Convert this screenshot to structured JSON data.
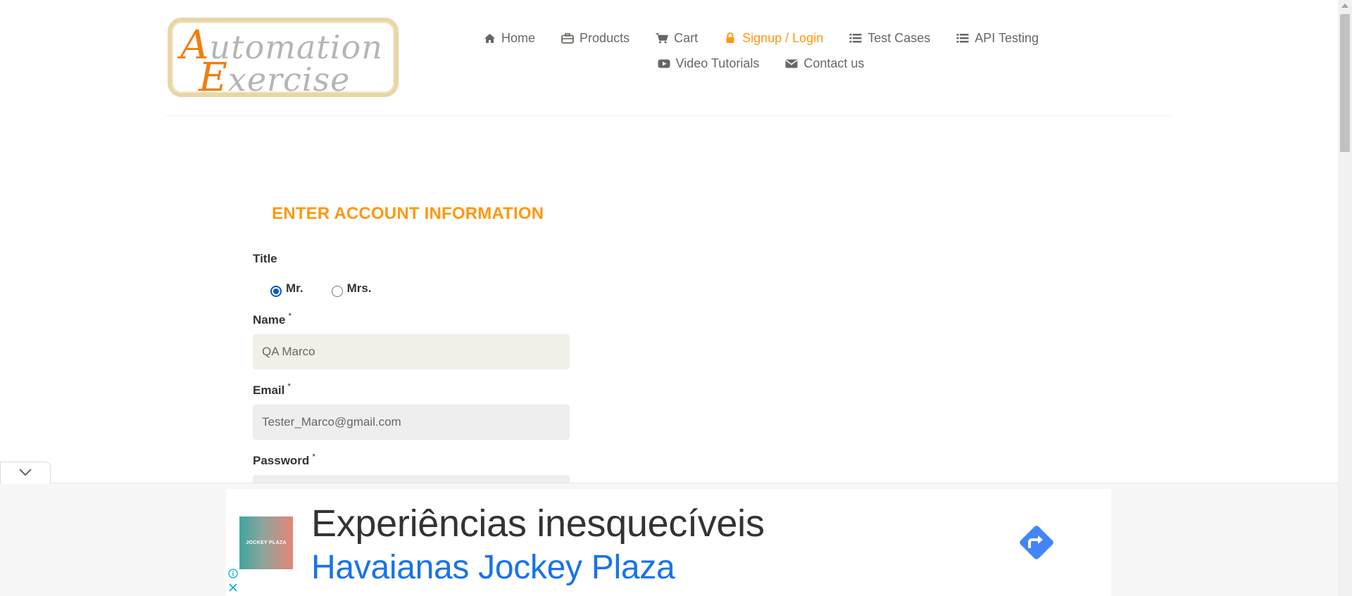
{
  "header": {
    "logo": {
      "line1_initial": "A",
      "line1_rest": "utomation",
      "line2_initial": "E",
      "line2_rest": "xercise"
    },
    "nav": {
      "row1": [
        {
          "label": "Home",
          "icon": "home-icon"
        },
        {
          "label": "Products",
          "icon": "products-icon"
        },
        {
          "label": "Cart",
          "icon": "cart-icon"
        },
        {
          "label": "Signup / Login",
          "icon": "lock-icon",
          "active": true
        },
        {
          "label": "Test Cases",
          "icon": "list-icon"
        },
        {
          "label": "API Testing",
          "icon": "list-icon"
        }
      ],
      "row2": [
        {
          "label": "Video Tutorials",
          "icon": "youtube-play-icon"
        },
        {
          "label": "Contact us",
          "icon": "envelope-icon"
        }
      ]
    }
  },
  "form": {
    "title": "ENTER ACCOUNT INFORMATION",
    "title_label": "Title",
    "radio_options": [
      "Mr.",
      "Mrs."
    ],
    "selected_title": "Mr.",
    "name_label": "Name",
    "name_value": "QA Marco",
    "email_label": "Email",
    "email_value": "Tester_Marco@gmail.com",
    "password_label": "Password",
    "required_marker": "*"
  },
  "ad": {
    "logo_text": "JOCKEY PLAZA",
    "headline": "Experiências inesquecíveis",
    "subline": "Havaianas Jockey Plaza",
    "cta_icon": "directions-icon",
    "info_icon": "info-icon",
    "close_icon": "close-icon",
    "toggle_icon": "chevron-down-icon"
  },
  "colors": {
    "accent": "#fe980f",
    "text": "#696763",
    "label": "#333333",
    "link_blue": "#1a73e8",
    "cta_blue": "#4285f4"
  }
}
